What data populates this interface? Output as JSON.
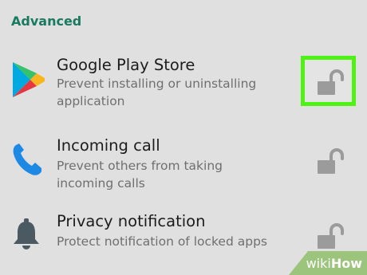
{
  "section": {
    "title": "Advanced"
  },
  "items": [
    {
      "title": "Google Play Store",
      "description": "Prevent installing or uninstalling application",
      "icon": "google-play-icon",
      "lock_state": "unlocked",
      "highlighted": true
    },
    {
      "title": "Incoming call",
      "description": "Prevent others from taking incoming calls",
      "icon": "phone-icon",
      "lock_state": "unlocked",
      "highlighted": false
    },
    {
      "title": "Privacy notification",
      "description": "Protect notification of locked apps",
      "icon": "bell-icon",
      "lock_state": "unlocked",
      "highlighted": false
    }
  ],
  "colors": {
    "background": "#e0e0e0",
    "section_header": "#197a5f",
    "highlight": "#4ef214",
    "lock_icon": "#9b9b9b",
    "phone_icon": "#1e88e5",
    "bell_icon": "#4b5963"
  },
  "watermark": {
    "part1": "wiki",
    "part2": "How"
  }
}
